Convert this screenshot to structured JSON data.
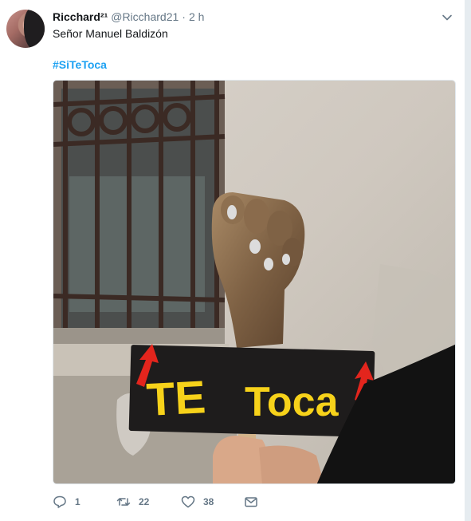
{
  "tweet": {
    "author_name": "Ricchard²¹",
    "handle": "@Ricchard21",
    "separator": "·",
    "time": "2 h",
    "text": "Señor Manuel Baldizón",
    "hashtag": "#SiTeToca"
  },
  "media": {
    "sign_text": "TE Toca",
    "description_icon": "photo"
  },
  "actions": {
    "reply_count": "1",
    "retweet_count": "22",
    "like_count": "38"
  },
  "colors": {
    "link": "#1da1f2",
    "secondary_text": "#657786",
    "sign_letters": "#f7d21a",
    "arrows": "#e3251d"
  },
  "icons": [
    "chevron-down-icon",
    "reply-icon",
    "retweet-icon",
    "heart-icon",
    "envelope-icon"
  ]
}
